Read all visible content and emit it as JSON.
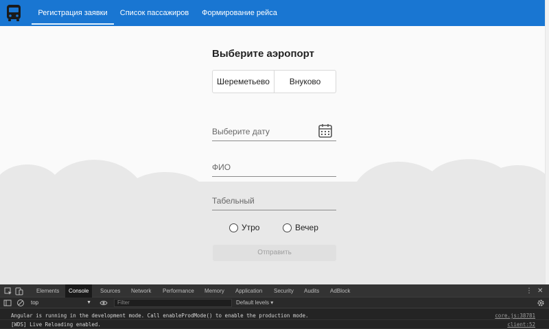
{
  "nav": {
    "tabs": [
      {
        "label": "Регистрация заявки",
        "active": true
      },
      {
        "label": "Список пассажиров",
        "active": false
      },
      {
        "label": "Формирование рейса",
        "active": false
      }
    ],
    "logo_icon": "bus-icon"
  },
  "form": {
    "title": "Выберите аэропорт",
    "airports": [
      "Шереметьево",
      "Внуково"
    ],
    "date_label": "Выберите дату",
    "fio_label": "ФИО",
    "tab_number_label": "Табельный",
    "shift_options": [
      "Утро",
      "Вечер"
    ],
    "submit_label": "Отправить"
  },
  "devtools": {
    "tabs": [
      "Elements",
      "Console",
      "Sources",
      "Network",
      "Performance",
      "Memory",
      "Application",
      "Security",
      "Audits",
      "AdBlock"
    ],
    "active_tab": "Console",
    "context": "top",
    "filter_placeholder": "Filter",
    "levels": "Default levels ▾",
    "messages": [
      {
        "text": "Angular is running in the development mode. Call enableProdMode() to enable the production mode.",
        "source": "core.js:38781"
      },
      {
        "text": "[WDS] Live Reloading enabled.",
        "source": "client:52"
      }
    ]
  },
  "colors": {
    "primary": "#1976d2",
    "background": "#fafafa",
    "cloud": "#e8e8e8",
    "devtools_bg": "#242424"
  }
}
